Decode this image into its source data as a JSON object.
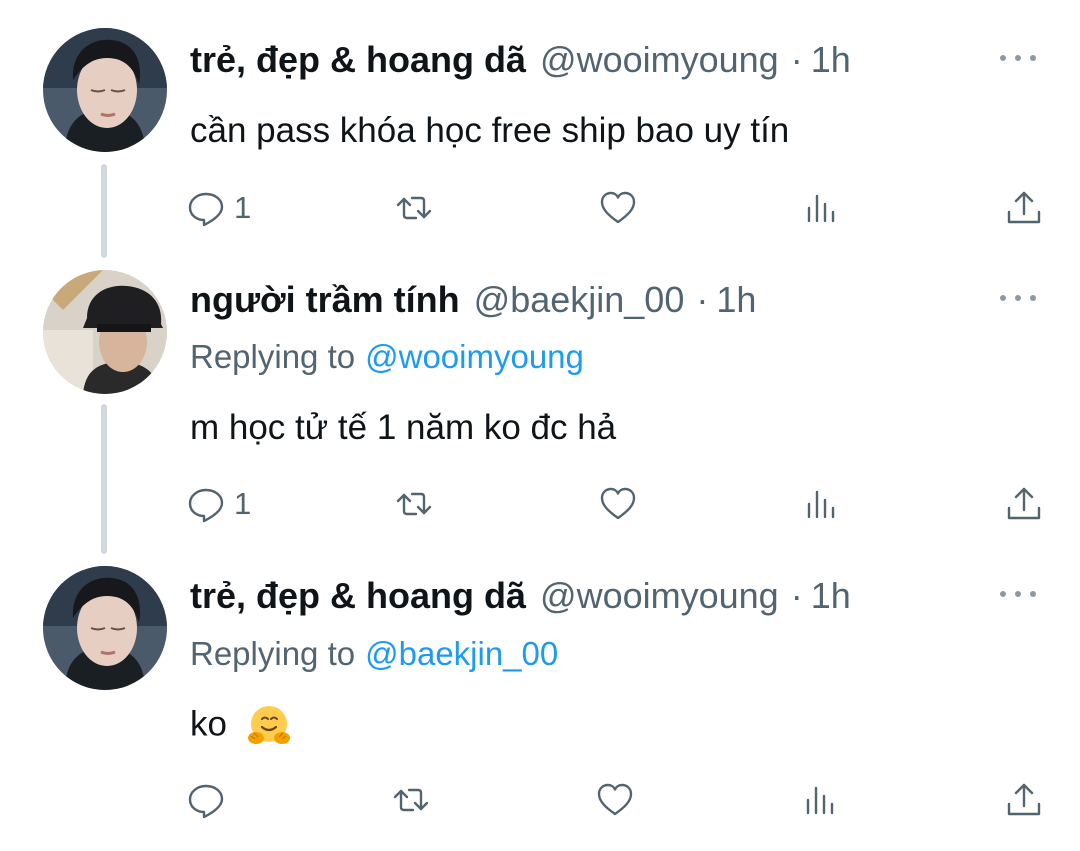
{
  "tweets": [
    {
      "display_name": "trẻ, đẹp & hoang dã",
      "handle": "@wooimyoung",
      "separator": "·",
      "time": "1h",
      "replying_label": "",
      "replying_to": "",
      "text": "cần pass khóa học free ship bao uy tín",
      "reply_count": "1"
    },
    {
      "display_name": "người trầm tính",
      "handle": "@baekjin_00",
      "separator": "·",
      "time": "1h",
      "replying_label": "Replying to",
      "replying_to": "@wooimyoung",
      "text": "m học tử tế 1 năm ko đc hả",
      "reply_count": "1"
    },
    {
      "display_name": "trẻ, đẹp & hoang dã",
      "handle": "@wooimyoung",
      "separator": "·",
      "time": "1h",
      "replying_label": "Replying to",
      "replying_to": "@baekjin_00",
      "text": "ko",
      "text_emoji": "hugging-face-emoji",
      "reply_count": ""
    }
  ],
  "icons": {
    "reply": "reply-icon",
    "retweet": "retweet-icon",
    "like": "like-icon",
    "views": "views-icon",
    "share": "share-icon",
    "more": "more-icon"
  },
  "colors": {
    "text": "#0f1419",
    "secondary": "#536471",
    "link": "#1d9bf0",
    "thread_line": "#cfd9de"
  }
}
